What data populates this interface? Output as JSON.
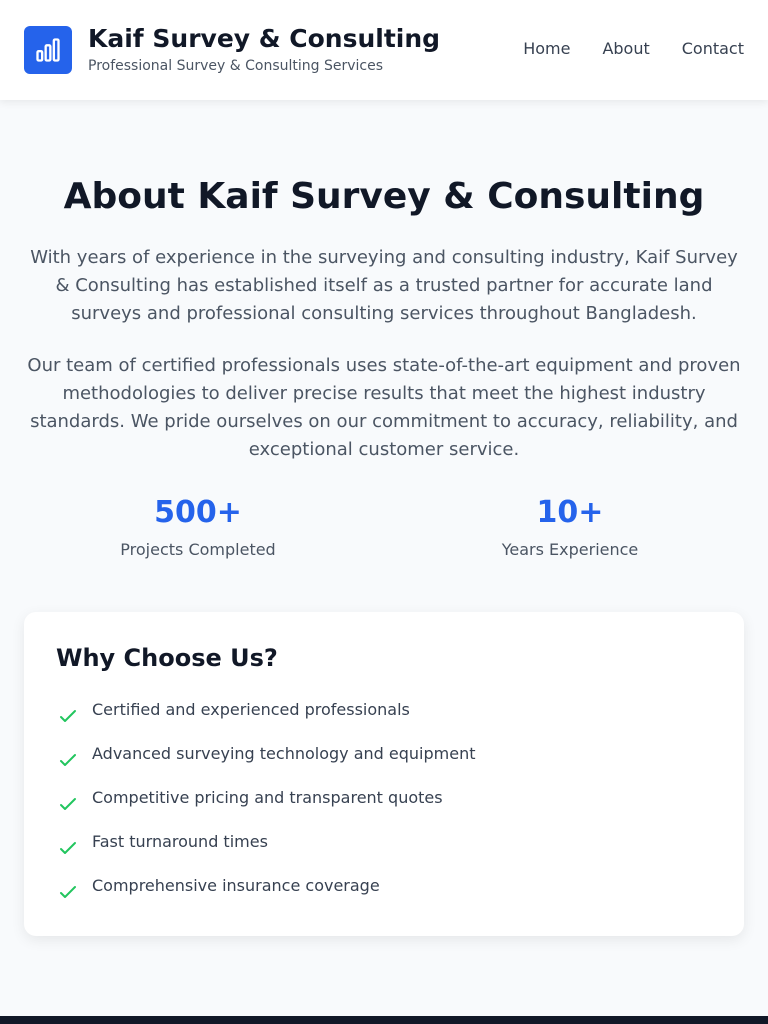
{
  "header": {
    "brand_title": "Kaif Survey & Consulting",
    "brand_subtitle": "Professional Survey & Consulting Services",
    "logo_icon": "bar-chart-icon",
    "accent_color": "#2563eb",
    "nav": [
      "Home",
      "About",
      "Contact"
    ]
  },
  "about": {
    "title": "About Kaif Survey & Consulting",
    "paragraphs": [
      "With years of experience in the surveying and consulting industry, Kaif Survey & Consulting has established itself as a trusted partner for accurate land surveys and professional consulting services throughout Bangladesh.",
      "Our team of certified professionals uses state-of-the-art equipment and proven methodologies to deliver precise results that meet the highest industry standards. We pride ourselves on our commitment to accuracy, reliability, and exceptional customer service."
    ],
    "stats": [
      {
        "value": "500+",
        "label": "Projects Completed"
      },
      {
        "value": "10+",
        "label": "Years Experience"
      }
    ]
  },
  "why_choose": {
    "title": "Why Choose Us?",
    "check_icon": "check-icon",
    "check_color": "#22c55e",
    "items": [
      "Certified and experienced professionals",
      "Advanced surveying technology and equipment",
      "Competitive pricing and transparent quotes",
      "Fast turnaround times",
      "Comprehensive insurance coverage"
    ]
  }
}
